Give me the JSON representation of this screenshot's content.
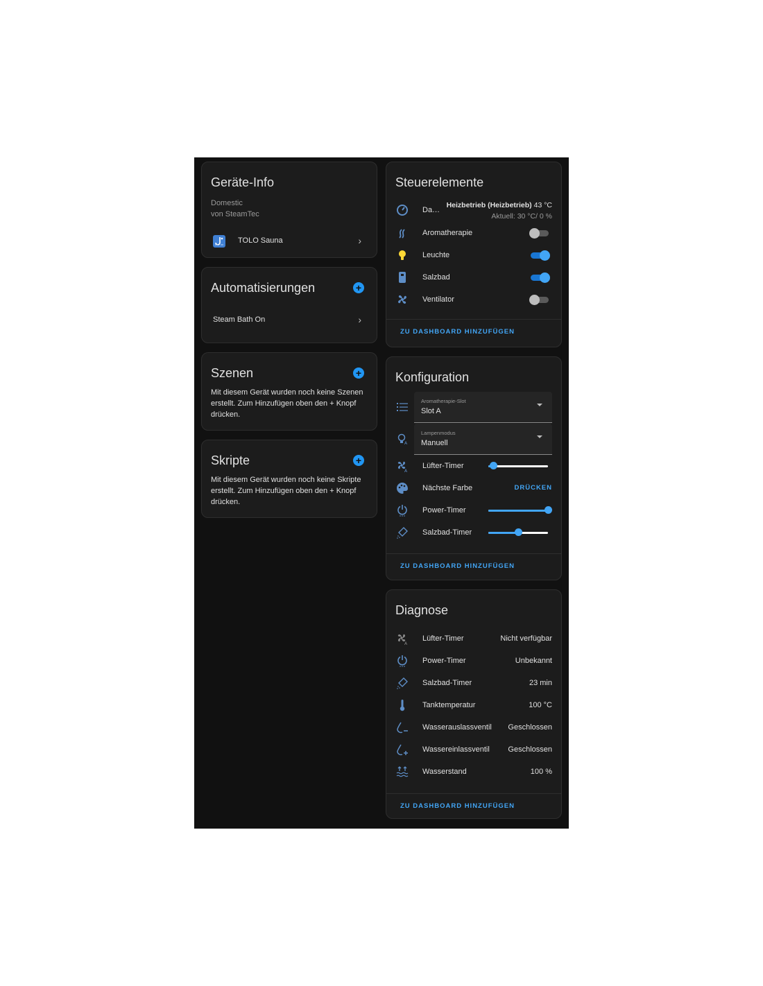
{
  "device_info": {
    "title": "Geräte-Info",
    "model": "Domestic",
    "manufacturer": "von SteamTec",
    "linked_device": "TOLO Sauna"
  },
  "automations": {
    "title": "Automatisierungen",
    "items": [
      "Steam Bath On"
    ]
  },
  "scenes": {
    "title": "Szenen",
    "empty_text": "Mit diesem Gerät wurden noch keine Szenen erstellt. Zum Hinzufügen oben den + Knopf drücken."
  },
  "scripts": {
    "title": "Skripte",
    "empty_text": "Mit diesem Gerät wurden noch keine Skripte erstellt. Zum Hinzufügen oben den + Knopf drücken."
  },
  "controls": {
    "title": "Steuerelemente",
    "climate": {
      "label": "Da…",
      "state": "Heizbetrieb (Heizbetrieb)",
      "target": "43 °C",
      "current": "Aktuell: 30 °C/ 0 %"
    },
    "switches": [
      {
        "label": "Aromatherapie",
        "on": false
      },
      {
        "label": "Leuchte",
        "on": true
      },
      {
        "label": "Salzbad",
        "on": true
      },
      {
        "label": "Ventilator",
        "on": false
      }
    ],
    "add_to_dashboard": "ZU DASHBOARD HINZUFÜGEN"
  },
  "configuration": {
    "title": "Konfiguration",
    "aroma_slot": {
      "label": "Aromatherapie-Slot",
      "value": "Slot A"
    },
    "lamp_mode": {
      "label": "Lampenmodus",
      "value": "Manuell"
    },
    "fan_timer": {
      "label": "Lüfter-Timer",
      "level": 0.08
    },
    "next_color": {
      "label": "Nächste Farbe",
      "button": "DRÜCKEN"
    },
    "power_timer": {
      "label": "Power-Timer",
      "level": 1.0
    },
    "salt_timer": {
      "label": "Salzbad-Timer",
      "level": 0.5
    },
    "add_to_dashboard": "ZU DASHBOARD HINZUFÜGEN"
  },
  "diagnostics": {
    "title": "Diagnose",
    "rows": [
      {
        "label": "Lüfter-Timer",
        "value": "Nicht verfügbar"
      },
      {
        "label": "Power-Timer",
        "value": "Unbekannt"
      },
      {
        "label": "Salzbad-Timer",
        "value": "23 min"
      },
      {
        "label": "Tanktemperatur",
        "value": "100 °C"
      },
      {
        "label": "Wasserauslassventil",
        "value": "Geschlossen"
      },
      {
        "label": "Wassereinlassventil",
        "value": "Geschlossen"
      },
      {
        "label": "Wasserstand",
        "value": "100 %"
      }
    ],
    "add_to_dashboard": "ZU DASHBOARD HINZUFÜGEN"
  },
  "colors": {
    "accent": "#42a5f5",
    "icon": "#5e8ec7",
    "bulb": "#fdd835"
  }
}
